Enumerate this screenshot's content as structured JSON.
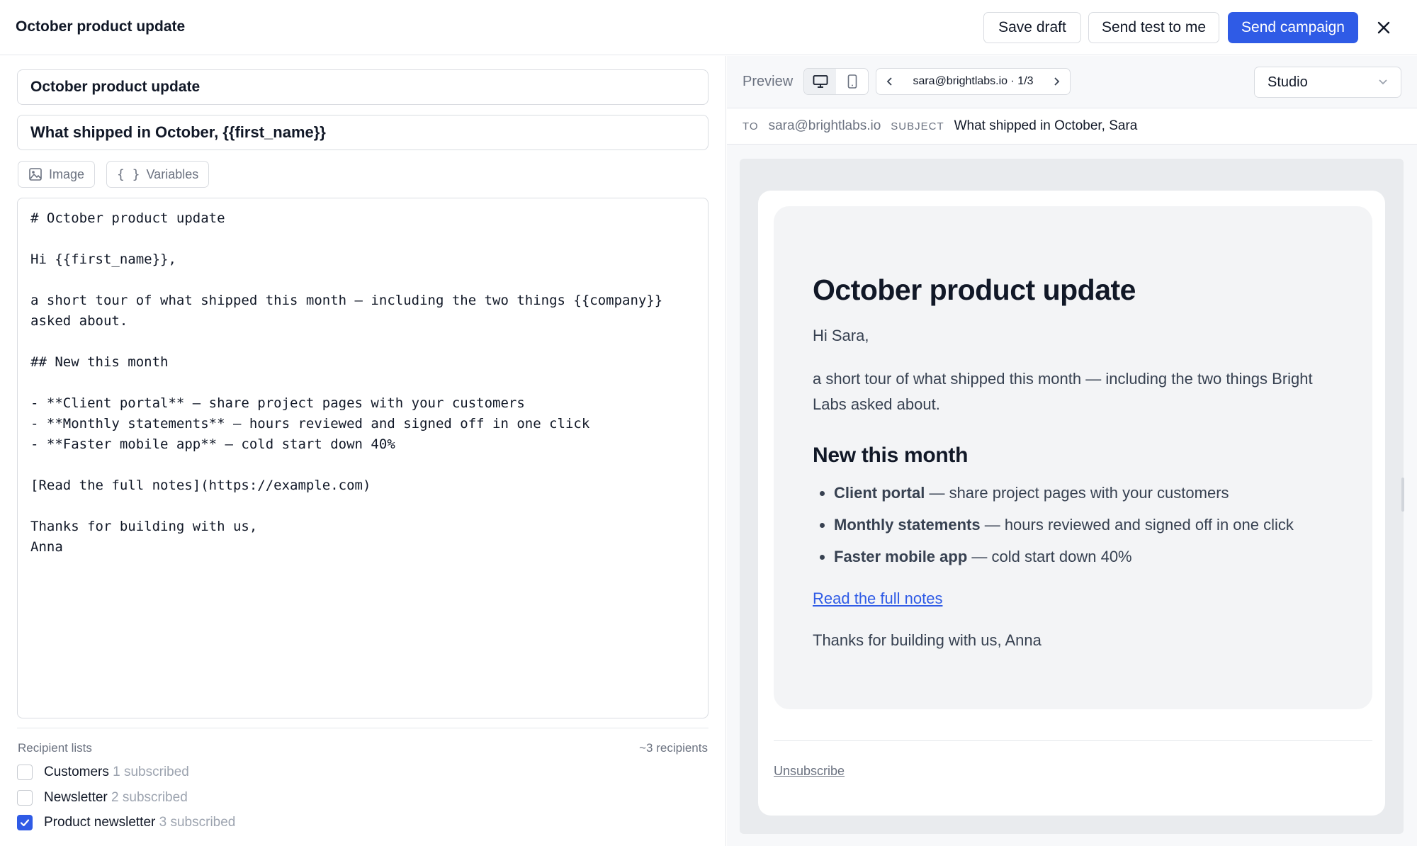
{
  "header": {
    "title": "October product update",
    "save_draft": "Save draft",
    "send_test": "Send test to me",
    "send_campaign": "Send campaign"
  },
  "editor": {
    "campaign_name": "October product update",
    "subject": "What shipped in October, {{first_name}}",
    "image_button": "Image",
    "variables_button": "Variables",
    "body": "# October product update\n\nHi {{first_name}},\n\na short tour of what shipped this month — including the two things {{company}}\nasked about.\n\n## New this month\n\n- **Client portal** — share project pages with your customers\n- **Monthly statements** — hours reviewed and signed off in one click\n- **Faster mobile app** — cold start down 40%\n\n[Read the full notes](https://example.com)\n\nThanks for building with us,\nAnna"
  },
  "recipients": {
    "label": "Recipient lists",
    "count": "~3 recipients",
    "lists": [
      {
        "name": "Customers",
        "subscribed": "1 subscribed",
        "checked": false
      },
      {
        "name": "Newsletter",
        "subscribed": "2 subscribed",
        "checked": false
      },
      {
        "name": "Product newsletter",
        "subscribed": "3 subscribed",
        "checked": true
      }
    ]
  },
  "preview": {
    "label": "Preview",
    "recipient_pager": "sara@brightlabs.io · 1/3",
    "template": "Studio",
    "to_label": "TO",
    "to_value": "sara@brightlabs.io",
    "subject_label": "SUBJECT",
    "subject_value": "What shipped in October, Sara"
  },
  "email": {
    "heading": "October product update",
    "greeting": "Hi Sara,",
    "intro": "a short tour of what shipped this month — including the two things Bright Labs asked about.",
    "section_heading": "New this month",
    "items": [
      {
        "bold": "Client portal",
        "rest": " — share project pages with your customers"
      },
      {
        "bold": "Monthly statements",
        "rest": " — hours reviewed and signed off in one click"
      },
      {
        "bold": "Faster mobile app",
        "rest": " — cold start down 40%"
      }
    ],
    "link_text": "Read the full notes",
    "signoff": "Thanks for building with us, Anna",
    "unsubscribe": "Unsubscribe"
  },
  "colors": {
    "accent": "#2f5be6",
    "border": "#d9dce1",
    "muted_text": "#6b7280"
  }
}
